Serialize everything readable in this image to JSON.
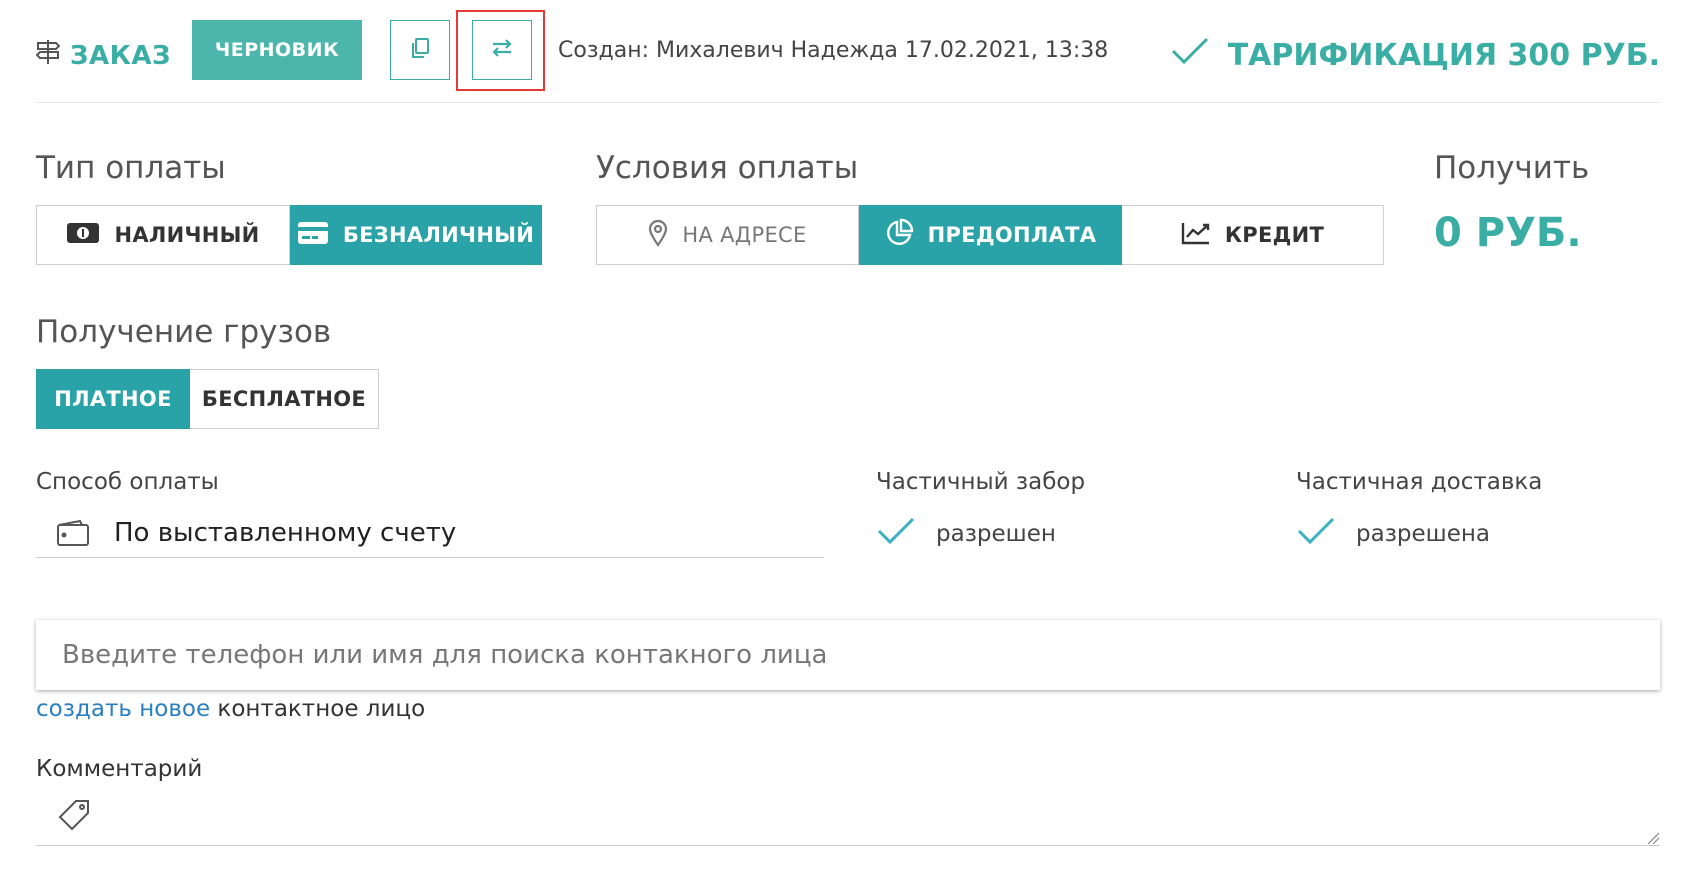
{
  "header": {
    "order_label": "ЗАКАЗ",
    "order_icon": "signpost-icon",
    "status_label": "ЧЕРНОВИК",
    "copy_icon": "copy-icon",
    "swap_icon": "swap-arrows-icon",
    "created_text": "Создан: Михалевич Надежда 17.02.2021, 13:38",
    "tarif_text": "ТАРИФИКАЦИЯ 300 РУБ.",
    "accent_color": "#3aaea5",
    "highlight_color": "#e53935"
  },
  "payment_type": {
    "label": "Тип оплаты",
    "options": [
      {
        "label": "НАЛИЧНЫЙ",
        "icon": "cash-icon",
        "active": false
      },
      {
        "label": "БЕЗНАЛИЧНЫЙ",
        "icon": "card-icon",
        "active": true
      }
    ]
  },
  "payment_terms": {
    "label": "Условия оплаты",
    "options": [
      {
        "label": "НА АДРЕСЕ",
        "icon": "location-pin-icon",
        "active": false
      },
      {
        "label": "ПРЕДОПЛАТА",
        "icon": "pie-chart-icon",
        "active": true
      },
      {
        "label": "КРЕДИТ",
        "icon": "line-chart-icon",
        "active": false
      }
    ]
  },
  "receive": {
    "label": "Получить",
    "value": "0 РУБ."
  },
  "cargo_receipt": {
    "label": "Получение грузов",
    "options": [
      {
        "label": "ПЛАТНОЕ",
        "active": true
      },
      {
        "label": "БЕСПЛАТНОЕ",
        "active": false
      }
    ]
  },
  "payment_method": {
    "label": "Способ оплаты",
    "icon": "wallet-icon",
    "value": "По выставленному счету"
  },
  "partial_pickup": {
    "label": "Частичный забор",
    "value": "разрешен"
  },
  "partial_delivery": {
    "label": "Частичная доставка",
    "value": "разрешена"
  },
  "contact": {
    "placeholder": "Введите телефон или имя для поиска контакного лица",
    "create_link": "создать новое",
    "create_suffix": " контактное лицо"
  },
  "comment": {
    "label": "Комментарий",
    "icon": "tag-icon"
  }
}
